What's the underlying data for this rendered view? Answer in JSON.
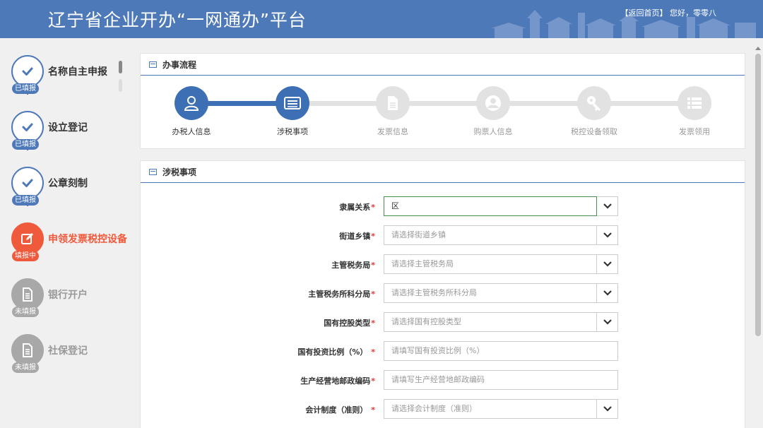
{
  "header": {
    "title": "辽宁省企业开办“一网通办”平台",
    "home_link": "【返回首页】",
    "greeting": "您好，零零八"
  },
  "sidebar": {
    "steps": [
      {
        "label": "名称自主申报",
        "status": "已填报",
        "state": "done",
        "icon": "check-icon"
      },
      {
        "label": "设立登记",
        "status": "已填报",
        "state": "done",
        "icon": "check-icon"
      },
      {
        "label": "公章刻制",
        "status": "已填报",
        "state": "done",
        "icon": "check-icon"
      },
      {
        "label": "申领发票税控设备",
        "status": "填报中",
        "state": "active",
        "icon": "edit-icon"
      },
      {
        "label": "银行开户",
        "status": "未填报",
        "state": "pending",
        "icon": "document-icon"
      },
      {
        "label": "社保登记",
        "status": "未填报",
        "state": "pending",
        "icon": "document-icon"
      }
    ]
  },
  "process_panel": {
    "title": "办事流程",
    "steps": [
      {
        "label": "办税人信息",
        "icon": "user-icon",
        "state": "on"
      },
      {
        "label": "涉税事项",
        "icon": "list-card-icon",
        "state": "on"
      },
      {
        "label": "发票信息",
        "icon": "document-icon",
        "state": "off"
      },
      {
        "label": "购票人信息",
        "icon": "person-circle-icon",
        "state": "off"
      },
      {
        "label": "税控设备领取",
        "icon": "key-icon",
        "state": "off"
      },
      {
        "label": "发票领用",
        "icon": "list-icon",
        "state": "off"
      }
    ]
  },
  "form_panel": {
    "title": "涉税事项",
    "fields": [
      {
        "label": "隶属关系",
        "required": "*",
        "type": "select",
        "value": "区",
        "placeholder": ""
      },
      {
        "label": "街道乡镇",
        "required": "*",
        "type": "select",
        "value": "",
        "placeholder": "请选择街道乡镇"
      },
      {
        "label": "主管税务局",
        "required": "*",
        "type": "select",
        "value": "",
        "placeholder": "请选择主管税务局"
      },
      {
        "label": "主管税务所科分局",
        "required": "*",
        "type": "select",
        "value": "",
        "placeholder": "请选择主管税务所科分局"
      },
      {
        "label": "国有控股类型",
        "required": "*",
        "type": "select",
        "value": "",
        "placeholder": "请选择国有控股类型"
      },
      {
        "label": "国有投资比例（%）",
        "required": " *",
        "type": "text",
        "value": "",
        "placeholder": "请填写国有投资比例（%）"
      },
      {
        "label": "生产经营地邮政编码",
        "required": "*",
        "type": "text",
        "value": "",
        "placeholder": "请填写生产经营地邮政编码"
      },
      {
        "label": "会计制度（准则）",
        "required": " *",
        "type": "select",
        "value": "",
        "placeholder": "请选择会计制度（准则）"
      }
    ]
  },
  "colors": {
    "header": "#4e79b9",
    "done": "#4e79b9",
    "active": "#f05a3c",
    "pending": "#a8a8a8",
    "process_on": "#3d6fb5"
  }
}
